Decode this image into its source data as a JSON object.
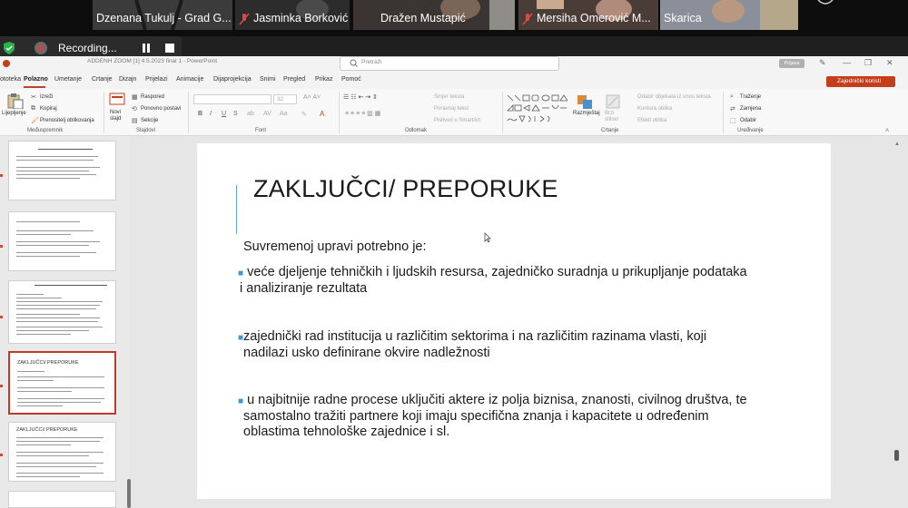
{
  "participants": [
    {
      "name": "Dzenana Tukulj - Grad G...",
      "muted": false
    },
    {
      "name": "Jasminka Borković",
      "muted": true
    },
    {
      "name": "Dražen Mustapić",
      "muted": false
    },
    {
      "name": "Mersiha Omerović M...",
      "muted": true
    },
    {
      "name": "Skarica",
      "muted": false
    }
  ],
  "recording": {
    "label": "Recording..."
  },
  "window": {
    "title": "ADDENH ZOOM [1] 4.5.2023 final 1 - PowerPoint",
    "search_placeholder": "Pretraži",
    "signin": "Prijava"
  },
  "tabs": [
    "ototeka",
    "Polazno",
    "Umetanje",
    "Crtanje",
    "Dizajn",
    "Prijelazi",
    "Animacije",
    "Dijaprojekcija",
    "Snimi",
    "Pregled",
    "Prikaz",
    "Pomoć"
  ],
  "share_label": "Zajednički koristi",
  "ribbon": {
    "clipboard": {
      "paste": "Lijepljenje",
      "cut": "Izreži",
      "copy": "Kopiraj",
      "format_painter": "Prenositelj oblikovanja",
      "group": "Međuspremnik"
    },
    "slides": {
      "new_slide": "Novi slajd",
      "layout": "Raspored",
      "reset": "Ponovno postavi",
      "section": "Sekcije",
      "group": "Slajdovi"
    },
    "font": {
      "size": "32",
      "group": "Font"
    },
    "paragraph": {
      "text_direction": "Smjer teksta",
      "align_text": "Poravnaj tekst",
      "smartart": "Pretvori u SmartArt",
      "group": "Odlomak"
    },
    "drawing": {
      "arrange": "Razmještaj",
      "quick_styles": "Brzi stilovi",
      "fill": "Odabir objekata iz unos teksta",
      "outline": "Kontura oblika",
      "effects": "Efekti oblika",
      "group": "Crtanje"
    },
    "editing": {
      "find": "Traženje",
      "replace": "Zamjena",
      "select": "Odabir",
      "group": "Uređivanje"
    }
  },
  "thumbnails": [
    {
      "title": "",
      "selected": false
    },
    {
      "title": "",
      "selected": false
    },
    {
      "title": "",
      "selected": false
    },
    {
      "title": "ZAKLJUČCI/ PREPORUKE",
      "selected": true
    },
    {
      "title": "ZAKLJUČCI/ PREPORUKE",
      "selected": false
    }
  ],
  "slide": {
    "title": "ZAKLJUČCI/ PREPORUKE",
    "intro": "Suvremenoj upravi potrebno  je:",
    "bullets": [
      [
        "veće djeljenje tehničkih i ljudskih resursa, zajedničko suradnja u prikupljanje podataka",
        " i  analiziranje rezultata"
      ],
      [
        "zajednički rad institucija u različitim sektorima i na različitim razinama vlasti, koji",
        "nadilazi usko definirane okvire nadležnosti"
      ],
      [
        "u najbitnije radne procese uključiti aktere iz polja biznisa, znanosti, civilnog društva, te",
        "samostalno tražiti  partnere koji imaju specifična znanja i kapacitete u određenim",
        "oblastima  tehnološke zajednice i sl."
      ]
    ]
  }
}
